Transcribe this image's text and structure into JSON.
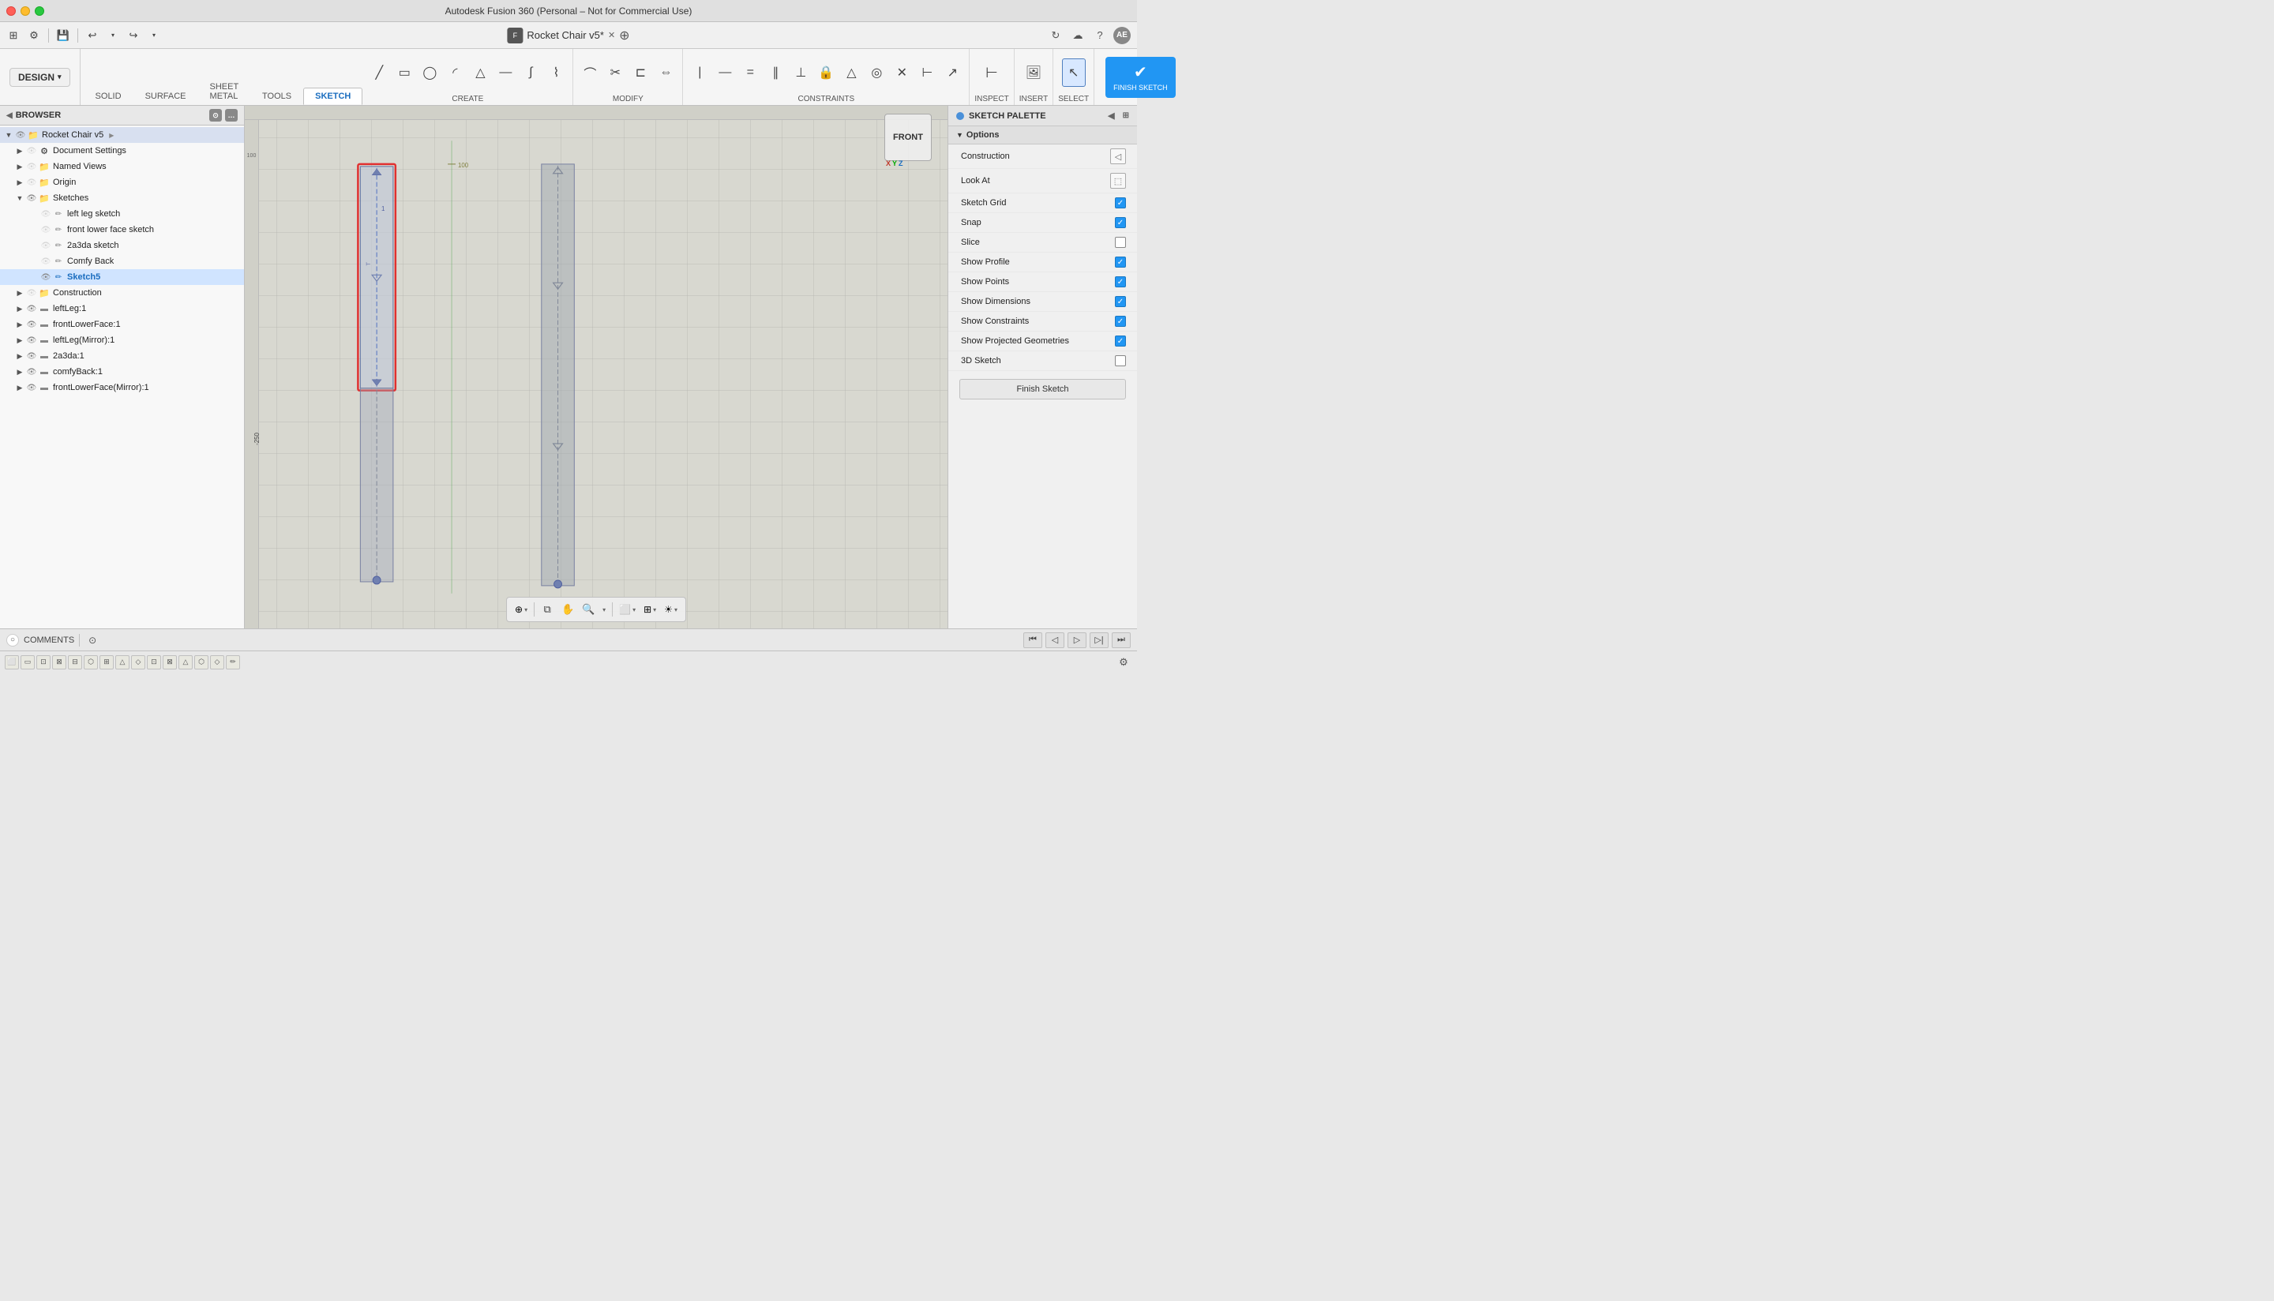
{
  "window": {
    "title": "Autodesk Fusion 360 (Personal – Not for Commercial Use)",
    "tab_title": "Rocket Chair v5*"
  },
  "toolbar": {
    "tabs": [
      "SOLID",
      "SURFACE",
      "SHEET METAL",
      "TOOLS",
      "SKETCH"
    ],
    "active_tab": "SKETCH",
    "design_label": "DESIGN",
    "sections": {
      "create": "CREATE",
      "modify": "MODIFY",
      "constraints": "CONSTRAINTS",
      "inspect": "INSPECT",
      "insert": "INSERT",
      "select": "SELECT",
      "finish": "FINISH SKETCH"
    }
  },
  "browser": {
    "title": "BROWSER",
    "root": "Rocket Chair v5",
    "items": [
      {
        "label": "Document Settings",
        "level": 1,
        "type": "settings",
        "expanded": false
      },
      {
        "label": "Named Views",
        "level": 1,
        "type": "folder",
        "expanded": false
      },
      {
        "label": "Origin",
        "level": 1,
        "type": "folder",
        "expanded": false
      },
      {
        "label": "Sketches",
        "level": 1,
        "type": "folder",
        "expanded": true
      },
      {
        "label": "left leg sketch",
        "level": 2,
        "type": "sketch"
      },
      {
        "label": "front lower face sketch",
        "level": 2,
        "type": "sketch"
      },
      {
        "label": "2a3da sketch",
        "level": 2,
        "type": "sketch"
      },
      {
        "label": "Comfy Back",
        "level": 2,
        "type": "sketch"
      },
      {
        "label": "Sketch5",
        "level": 2,
        "type": "sketch",
        "visible": true,
        "active": true
      },
      {
        "label": "Construction",
        "level": 1,
        "type": "folder",
        "expanded": false
      },
      {
        "label": "leftLeg:1",
        "level": 1,
        "type": "body"
      },
      {
        "label": "frontLowerFace:1",
        "level": 1,
        "type": "body"
      },
      {
        "label": "leftLeg(Mirror):1",
        "level": 1,
        "type": "body"
      },
      {
        "label": "2a3da:1",
        "level": 1,
        "type": "body"
      },
      {
        "label": "comfyBack:1",
        "level": 1,
        "type": "body"
      },
      {
        "label": "frontLowerFace(Mirror):1",
        "level": 1,
        "type": "body"
      }
    ]
  },
  "sketch_palette": {
    "title": "SKETCH PALETTE",
    "options_label": "Options",
    "rows": [
      {
        "label": "Construction",
        "type": "icon_btn",
        "icon": "◁"
      },
      {
        "label": "Look At",
        "type": "icon_btn",
        "icon": "⬚"
      },
      {
        "label": "Sketch Grid",
        "type": "checkbox",
        "checked": true
      },
      {
        "label": "Snap",
        "type": "checkbox",
        "checked": true
      },
      {
        "label": "Slice",
        "type": "checkbox",
        "checked": false
      },
      {
        "label": "Show Profile",
        "type": "checkbox",
        "checked": true
      },
      {
        "label": "Show Points",
        "type": "checkbox",
        "checked": true
      },
      {
        "label": "Show Dimensions",
        "type": "checkbox",
        "checked": true
      },
      {
        "label": "Show Constraints",
        "type": "checkbox",
        "checked": true
      },
      {
        "label": "Show Projected Geometries",
        "type": "checkbox",
        "checked": true
      },
      {
        "label": "3D Sketch",
        "type": "checkbox",
        "checked": false
      }
    ],
    "finish_button": "Finish Sketch"
  },
  "bottom_bar": {
    "comments": "COMMENTS"
  },
  "viewport": {
    "view_label": "FRONT"
  }
}
